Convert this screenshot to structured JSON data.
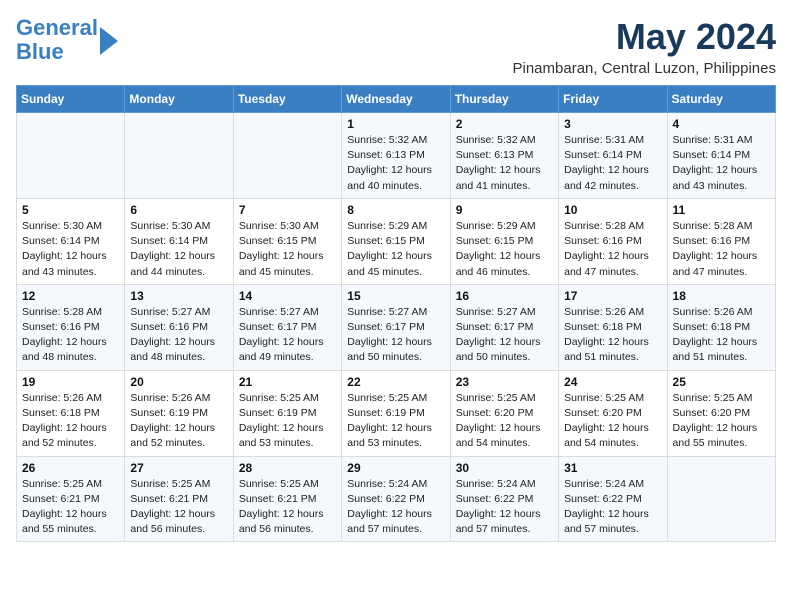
{
  "logo": {
    "line1": "General",
    "line2": "Blue"
  },
  "title": "May 2024",
  "location": "Pinambaran, Central Luzon, Philippines",
  "weekdays": [
    "Sunday",
    "Monday",
    "Tuesday",
    "Wednesday",
    "Thursday",
    "Friday",
    "Saturday"
  ],
  "weeks": [
    [
      {
        "day": "",
        "info": ""
      },
      {
        "day": "",
        "info": ""
      },
      {
        "day": "",
        "info": ""
      },
      {
        "day": "1",
        "info": "Sunrise: 5:32 AM\nSunset: 6:13 PM\nDaylight: 12 hours\nand 40 minutes."
      },
      {
        "day": "2",
        "info": "Sunrise: 5:32 AM\nSunset: 6:13 PM\nDaylight: 12 hours\nand 41 minutes."
      },
      {
        "day": "3",
        "info": "Sunrise: 5:31 AM\nSunset: 6:14 PM\nDaylight: 12 hours\nand 42 minutes."
      },
      {
        "day": "4",
        "info": "Sunrise: 5:31 AM\nSunset: 6:14 PM\nDaylight: 12 hours\nand 43 minutes."
      }
    ],
    [
      {
        "day": "5",
        "info": "Sunrise: 5:30 AM\nSunset: 6:14 PM\nDaylight: 12 hours\nand 43 minutes."
      },
      {
        "day": "6",
        "info": "Sunrise: 5:30 AM\nSunset: 6:14 PM\nDaylight: 12 hours\nand 44 minutes."
      },
      {
        "day": "7",
        "info": "Sunrise: 5:30 AM\nSunset: 6:15 PM\nDaylight: 12 hours\nand 45 minutes."
      },
      {
        "day": "8",
        "info": "Sunrise: 5:29 AM\nSunset: 6:15 PM\nDaylight: 12 hours\nand 45 minutes."
      },
      {
        "day": "9",
        "info": "Sunrise: 5:29 AM\nSunset: 6:15 PM\nDaylight: 12 hours\nand 46 minutes."
      },
      {
        "day": "10",
        "info": "Sunrise: 5:28 AM\nSunset: 6:16 PM\nDaylight: 12 hours\nand 47 minutes."
      },
      {
        "day": "11",
        "info": "Sunrise: 5:28 AM\nSunset: 6:16 PM\nDaylight: 12 hours\nand 47 minutes."
      }
    ],
    [
      {
        "day": "12",
        "info": "Sunrise: 5:28 AM\nSunset: 6:16 PM\nDaylight: 12 hours\nand 48 minutes."
      },
      {
        "day": "13",
        "info": "Sunrise: 5:27 AM\nSunset: 6:16 PM\nDaylight: 12 hours\nand 48 minutes."
      },
      {
        "day": "14",
        "info": "Sunrise: 5:27 AM\nSunset: 6:17 PM\nDaylight: 12 hours\nand 49 minutes."
      },
      {
        "day": "15",
        "info": "Sunrise: 5:27 AM\nSunset: 6:17 PM\nDaylight: 12 hours\nand 50 minutes."
      },
      {
        "day": "16",
        "info": "Sunrise: 5:27 AM\nSunset: 6:17 PM\nDaylight: 12 hours\nand 50 minutes."
      },
      {
        "day": "17",
        "info": "Sunrise: 5:26 AM\nSunset: 6:18 PM\nDaylight: 12 hours\nand 51 minutes."
      },
      {
        "day": "18",
        "info": "Sunrise: 5:26 AM\nSunset: 6:18 PM\nDaylight: 12 hours\nand 51 minutes."
      }
    ],
    [
      {
        "day": "19",
        "info": "Sunrise: 5:26 AM\nSunset: 6:18 PM\nDaylight: 12 hours\nand 52 minutes."
      },
      {
        "day": "20",
        "info": "Sunrise: 5:26 AM\nSunset: 6:19 PM\nDaylight: 12 hours\nand 52 minutes."
      },
      {
        "day": "21",
        "info": "Sunrise: 5:25 AM\nSunset: 6:19 PM\nDaylight: 12 hours\nand 53 minutes."
      },
      {
        "day": "22",
        "info": "Sunrise: 5:25 AM\nSunset: 6:19 PM\nDaylight: 12 hours\nand 53 minutes."
      },
      {
        "day": "23",
        "info": "Sunrise: 5:25 AM\nSunset: 6:20 PM\nDaylight: 12 hours\nand 54 minutes."
      },
      {
        "day": "24",
        "info": "Sunrise: 5:25 AM\nSunset: 6:20 PM\nDaylight: 12 hours\nand 54 minutes."
      },
      {
        "day": "25",
        "info": "Sunrise: 5:25 AM\nSunset: 6:20 PM\nDaylight: 12 hours\nand 55 minutes."
      }
    ],
    [
      {
        "day": "26",
        "info": "Sunrise: 5:25 AM\nSunset: 6:21 PM\nDaylight: 12 hours\nand 55 minutes."
      },
      {
        "day": "27",
        "info": "Sunrise: 5:25 AM\nSunset: 6:21 PM\nDaylight: 12 hours\nand 56 minutes."
      },
      {
        "day": "28",
        "info": "Sunrise: 5:25 AM\nSunset: 6:21 PM\nDaylight: 12 hours\nand 56 minutes."
      },
      {
        "day": "29",
        "info": "Sunrise: 5:24 AM\nSunset: 6:22 PM\nDaylight: 12 hours\nand 57 minutes."
      },
      {
        "day": "30",
        "info": "Sunrise: 5:24 AM\nSunset: 6:22 PM\nDaylight: 12 hours\nand 57 minutes."
      },
      {
        "day": "31",
        "info": "Sunrise: 5:24 AM\nSunset: 6:22 PM\nDaylight: 12 hours\nand 57 minutes."
      },
      {
        "day": "",
        "info": ""
      }
    ]
  ]
}
